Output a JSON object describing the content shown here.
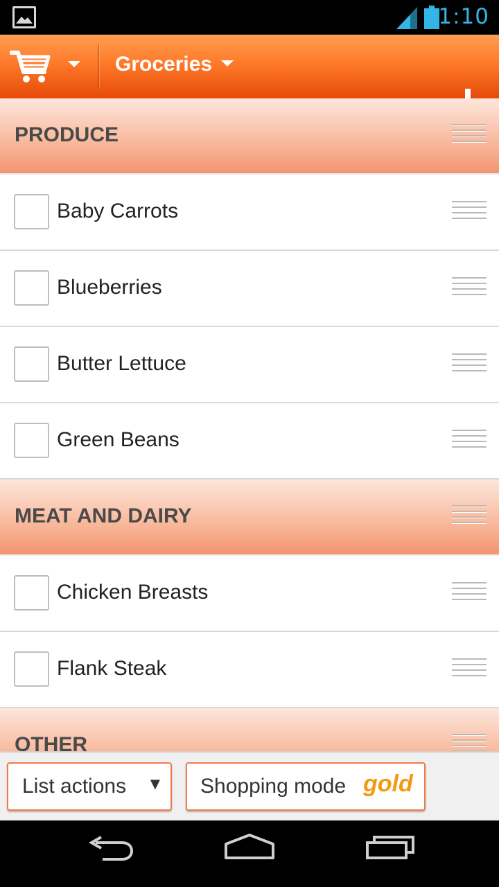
{
  "status_bar": {
    "time": "1:10",
    "icons": [
      "picture-icon",
      "signal-icon",
      "battery-icon"
    ],
    "accent": "#33b5e5"
  },
  "action_bar": {
    "title": "Groceries",
    "icons": [
      "cart-icon",
      "add-icon"
    ],
    "gradient": [
      "#ff9d52",
      "#e54a08"
    ]
  },
  "sections": [
    {
      "title": "PRODUCE",
      "items": [
        {
          "label": "Baby Carrots",
          "checked": false
        },
        {
          "label": "Blueberries",
          "checked": false
        },
        {
          "label": "Butter Lettuce",
          "checked": false
        },
        {
          "label": "Green Beans",
          "checked": false
        }
      ]
    },
    {
      "title": "MEAT AND DAIRY",
      "items": [
        {
          "label": "Chicken Breasts",
          "checked": false
        },
        {
          "label": "Flank Steak",
          "checked": false
        }
      ]
    },
    {
      "title": "OTHER",
      "items": []
    }
  ],
  "toolbar": {
    "list_actions_label": "List actions",
    "list_actions_arrow": "▼",
    "shopping_mode_label": "Shopping mode",
    "gold_label": "gold"
  },
  "nav_bar": {
    "icons": [
      "back-icon",
      "home-icon",
      "recent-apps-icon"
    ]
  }
}
